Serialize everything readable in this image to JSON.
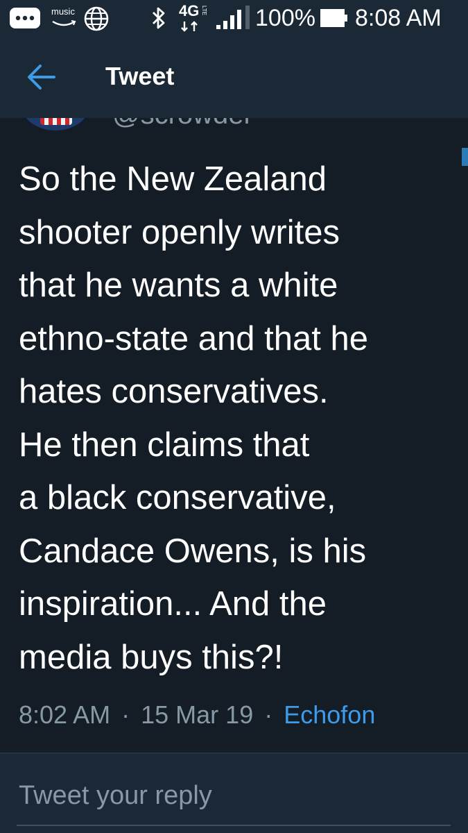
{
  "status_bar": {
    "music_label": "music",
    "network": "4G",
    "network_sub": "LTE",
    "battery": "100%",
    "time": "8:08 AM"
  },
  "header": {
    "back_icon": "back-arrow-icon",
    "title": "Tweet"
  },
  "tweet": {
    "handle": "@scrowder",
    "text_lines": [
      "So the New Zealand",
      "shooter openly writes",
      "that he wants a white",
      "ethno-state and that he",
      "hates conservatives.",
      "He then claims that",
      "a black conservative,",
      "Candace Owens, is his",
      "inspiration... And the",
      "media buys this?!"
    ],
    "time": "8:02 AM",
    "date": "15 Mar 19",
    "source": "Echofon",
    "separator": "·"
  },
  "reply": {
    "placeholder": "Tweet your reply"
  },
  "colors": {
    "background": "#141d26",
    "bar": "#1b2836",
    "accent": "#3d9be9",
    "muted": "#8899a6"
  }
}
